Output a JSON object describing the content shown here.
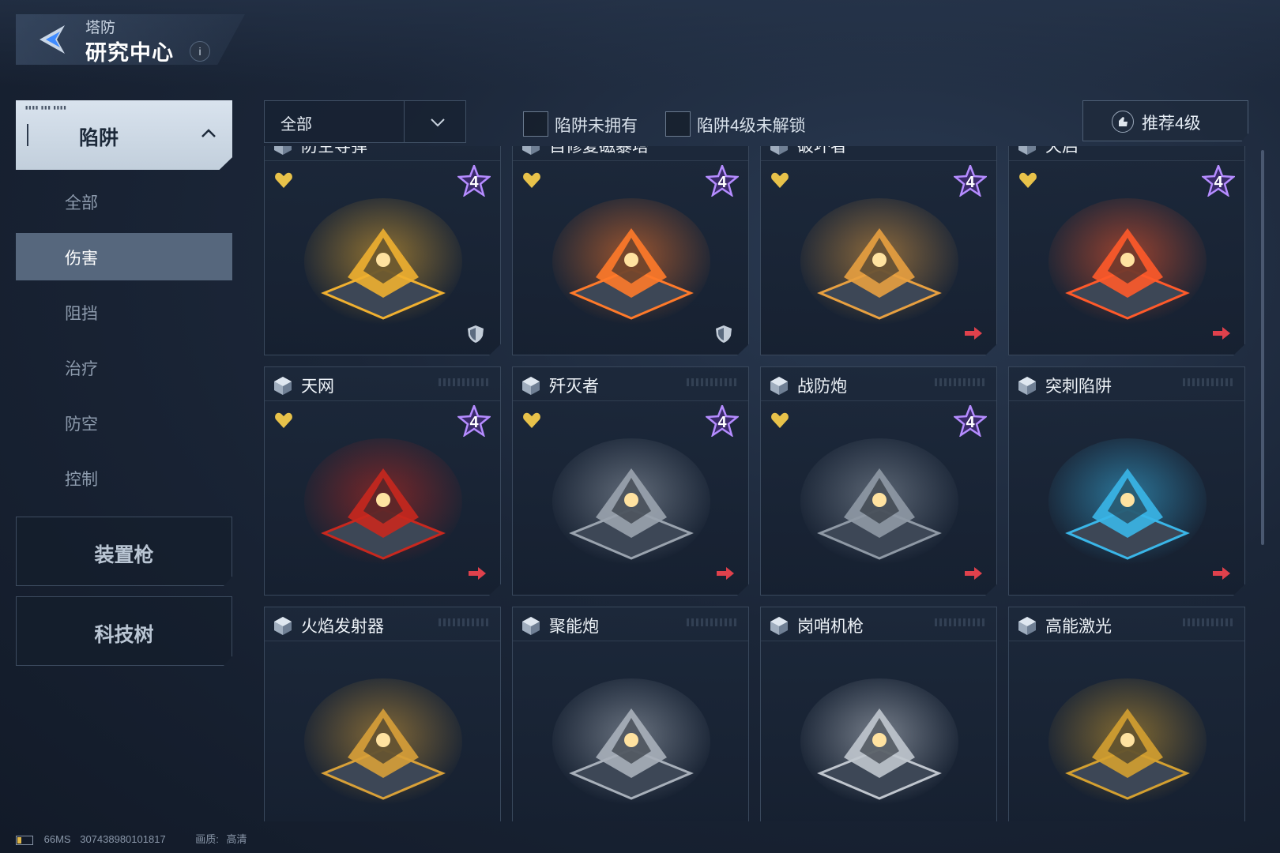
{
  "header": {
    "subtitle": "塔防",
    "title": "研究中心",
    "info_label": "i"
  },
  "sidebar": {
    "open_category": "陷阱",
    "subcategories": [
      "全部",
      "伤害",
      "阻挡",
      "治疗",
      "防空",
      "控制"
    ],
    "active_subcategory": "伤害",
    "categories": [
      "装置枪",
      "科技树"
    ]
  },
  "filters": {
    "dropdown_value": "全部",
    "checkbox_1": "陷阱未拥有",
    "checkbox_2": "陷阱4级未解锁",
    "recommend_button": "推荐4级"
  },
  "cards": [
    {
      "name": "防空导弹",
      "badge": "4",
      "favorite": true,
      "corner": "shield-icon",
      "color": "#f0b030"
    },
    {
      "name": "自修复磁暴塔",
      "badge": "4",
      "favorite": true,
      "corner": "shield-icon",
      "color": "#ff7a2a"
    },
    {
      "name": "破坏者",
      "badge": "4",
      "favorite": true,
      "corner": "arrow-icon",
      "color": "#e8a040"
    },
    {
      "name": "天启",
      "badge": "4",
      "favorite": true,
      "corner": "arrow-icon",
      "color": "#ff5a2a"
    },
    {
      "name": "天网",
      "badge": "4",
      "favorite": true,
      "corner": "arrow-icon",
      "color": "#c8281e"
    },
    {
      "name": "歼灭者",
      "badge": "4",
      "favorite": true,
      "corner": "arrow-icon",
      "color": "#9aa3ae"
    },
    {
      "name": "战防炮",
      "badge": "4",
      "favorite": true,
      "corner": "arrow-icon",
      "color": "#8f99a5"
    },
    {
      "name": "突刺陷阱",
      "badge": "",
      "favorite": false,
      "corner": "arrow-icon",
      "color": "#3ab6e8"
    },
    {
      "name": "火焰发射器",
      "badge": "",
      "favorite": false,
      "corner": "",
      "color": "#d8a038"
    },
    {
      "name": "聚能炮",
      "badge": "",
      "favorite": false,
      "corner": "",
      "color": "#a8b0ba"
    },
    {
      "name": "岗哨机枪",
      "badge": "",
      "favorite": false,
      "corner": "",
      "color": "#c0c6ce"
    },
    {
      "name": "高能激光",
      "badge": "",
      "favorite": false,
      "corner": "",
      "color": "#d4a030"
    }
  ],
  "footer": {
    "ping": "66MS",
    "id": "307438980101817",
    "quality_label": "画质:",
    "quality_value": "高清"
  },
  "colors": {
    "accent": "#56677d",
    "star": "#b58cff",
    "heart": "#e8c24a",
    "arrow": "#e0414c"
  }
}
